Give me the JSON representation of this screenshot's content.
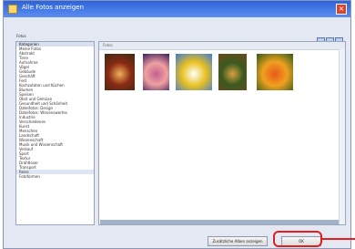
{
  "window": {
    "title": "Alle Fotos anzeigen",
    "close_glyph": "×"
  },
  "filter": {
    "label": "Fotos"
  },
  "categories": [
    "Kategorien",
    "Meine Fotos",
    "Abstrakt",
    "Tiere",
    "Aufnahme",
    "Vögel",
    "Gebäude",
    "Geschäft",
    "Fest",
    "Kochzutaten und Küchen",
    "Blumen",
    "Speisen",
    "Obst und Gemüse",
    "Gesundheit und Schönheit",
    "Dateifotos: Design",
    "Dateifotos: Wissenswertes",
    "Industrie",
    "Verschiedenes",
    "Kunst",
    "Menschen",
    "Landschaft",
    "Wissenschaft",
    "Musik und Wissenschaft",
    "Verkauf",
    "Sport",
    "Textur",
    "Drahtloser",
    "Transport",
    "Reise",
    "Fotoformen"
  ],
  "selected_index": 28,
  "photos": {
    "header": "Fotos",
    "items": [
      {
        "name": "papaya-photo",
        "colors": [
          "#3b2a12",
          "#f2b05a",
          "#8a2a14"
        ]
      },
      {
        "name": "sunset-photo",
        "colors": [
          "#3a1a5a",
          "#c46090",
          "#f0a0a0"
        ]
      },
      {
        "name": "flowers-photo",
        "colors": [
          "#3a7ad8",
          "#ffffff",
          "#e8c020"
        ]
      },
      {
        "name": "lion-photo",
        "colors": [
          "#6b4a1a",
          "#d8a040",
          "#3a5a20"
        ]
      },
      {
        "name": "vegetables-photo",
        "colors": [
          "#2a5a18",
          "#e85a18",
          "#f0a020"
        ]
      }
    ]
  },
  "buttons": {
    "show_all": "Zusätzliche Alben anzeigen",
    "ok": "OK"
  },
  "colors": {
    "titlebar": "#2c63d8",
    "highlight": "#e02020",
    "selection": "#dde6f5"
  }
}
